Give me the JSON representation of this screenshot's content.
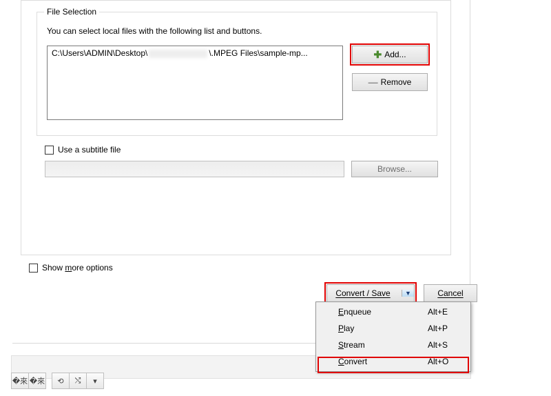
{
  "file_selection": {
    "title": "File Selection",
    "instructions": "You can select local files with the following list and buttons.",
    "path_prefix": "C:\\Users\\ADMIN\\Desktop\\",
    "path_suffix": "\\.MPEG Files\\sample-mp...",
    "add_label": "Add...",
    "remove_label": "Remove"
  },
  "subtitle": {
    "label": "Use a subtitle file",
    "browse_label": "Browse..."
  },
  "more_options_label": "Show more options",
  "convert_save_label": "Convert / Save",
  "cancel_label": "Cancel",
  "menu": {
    "items": [
      {
        "letter": "E",
        "rest": "nqueue",
        "shortcut": "Alt+E"
      },
      {
        "letter": "P",
        "rest": "lay",
        "shortcut": "Alt+P"
      },
      {
        "letter": "S",
        "rest": "tream",
        "shortcut": "Alt+S"
      },
      {
        "letter": "C",
        "rest": "onvert",
        "shortcut": "Alt+O"
      }
    ]
  },
  "icons": {
    "slider": "�來",
    "loop": "⟲",
    "shuffle": "⤭",
    "chevron": "▾"
  }
}
